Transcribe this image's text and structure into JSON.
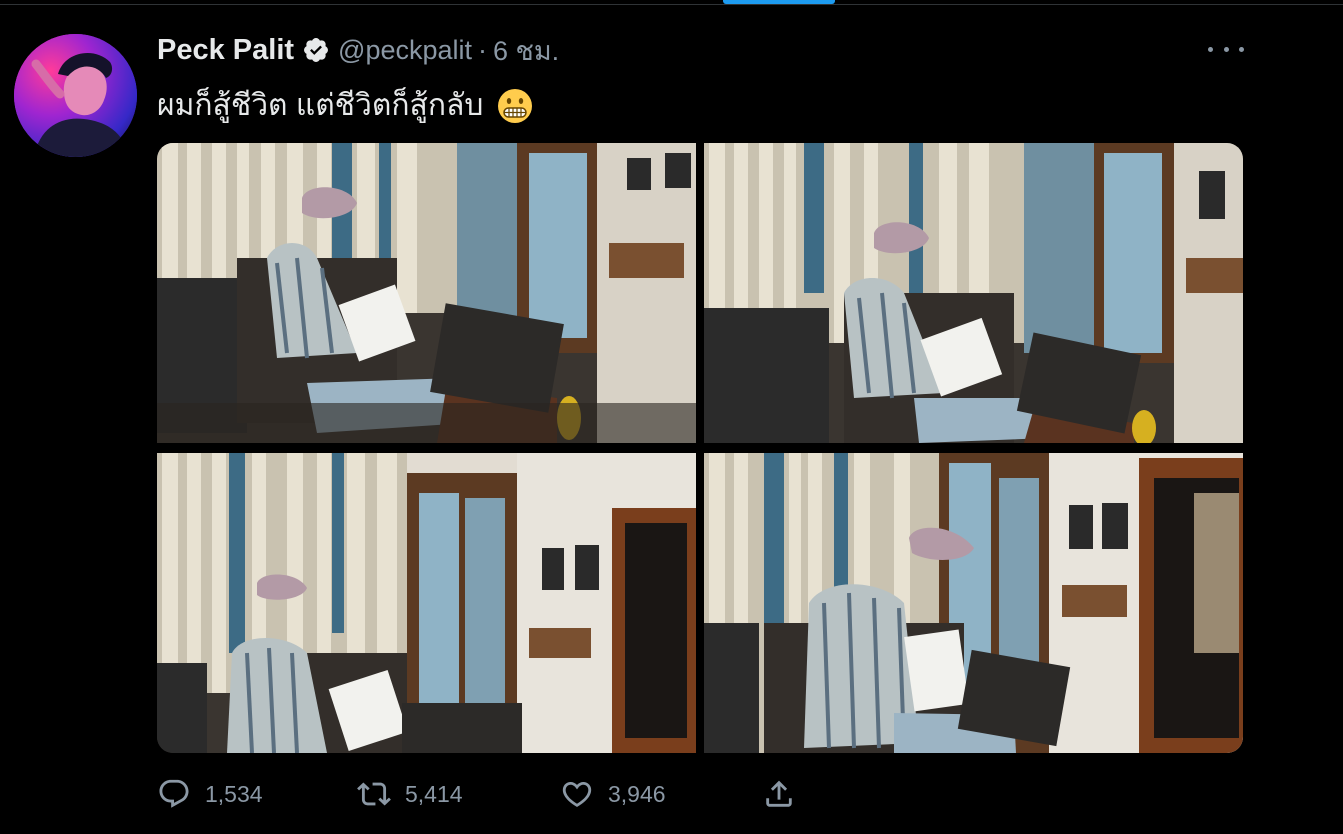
{
  "tweet": {
    "author": {
      "display_name": "Peck Palit",
      "handle": "@peckpalit",
      "verified": true,
      "avatar_icon": "profile-avatar"
    },
    "separator": "·",
    "timestamp": "6 ชม.",
    "text": "ผมก็สู้ชีวิต แต่ชีวิตก็สู้กลับ",
    "emoji_icon": "grimacing-face-emoji",
    "media_count": 4
  },
  "actions": {
    "reply": {
      "icon": "reply-icon",
      "count": "1,534"
    },
    "retweet": {
      "icon": "retweet-icon",
      "count": "5,414"
    },
    "like": {
      "icon": "heart-icon",
      "count": "3,946"
    },
    "share": {
      "icon": "share-icon"
    }
  },
  "colors": {
    "background": "#000000",
    "text_primary": "#e7e9ea",
    "text_secondary": "#8b98a5",
    "accent": "#1d9bf0"
  }
}
